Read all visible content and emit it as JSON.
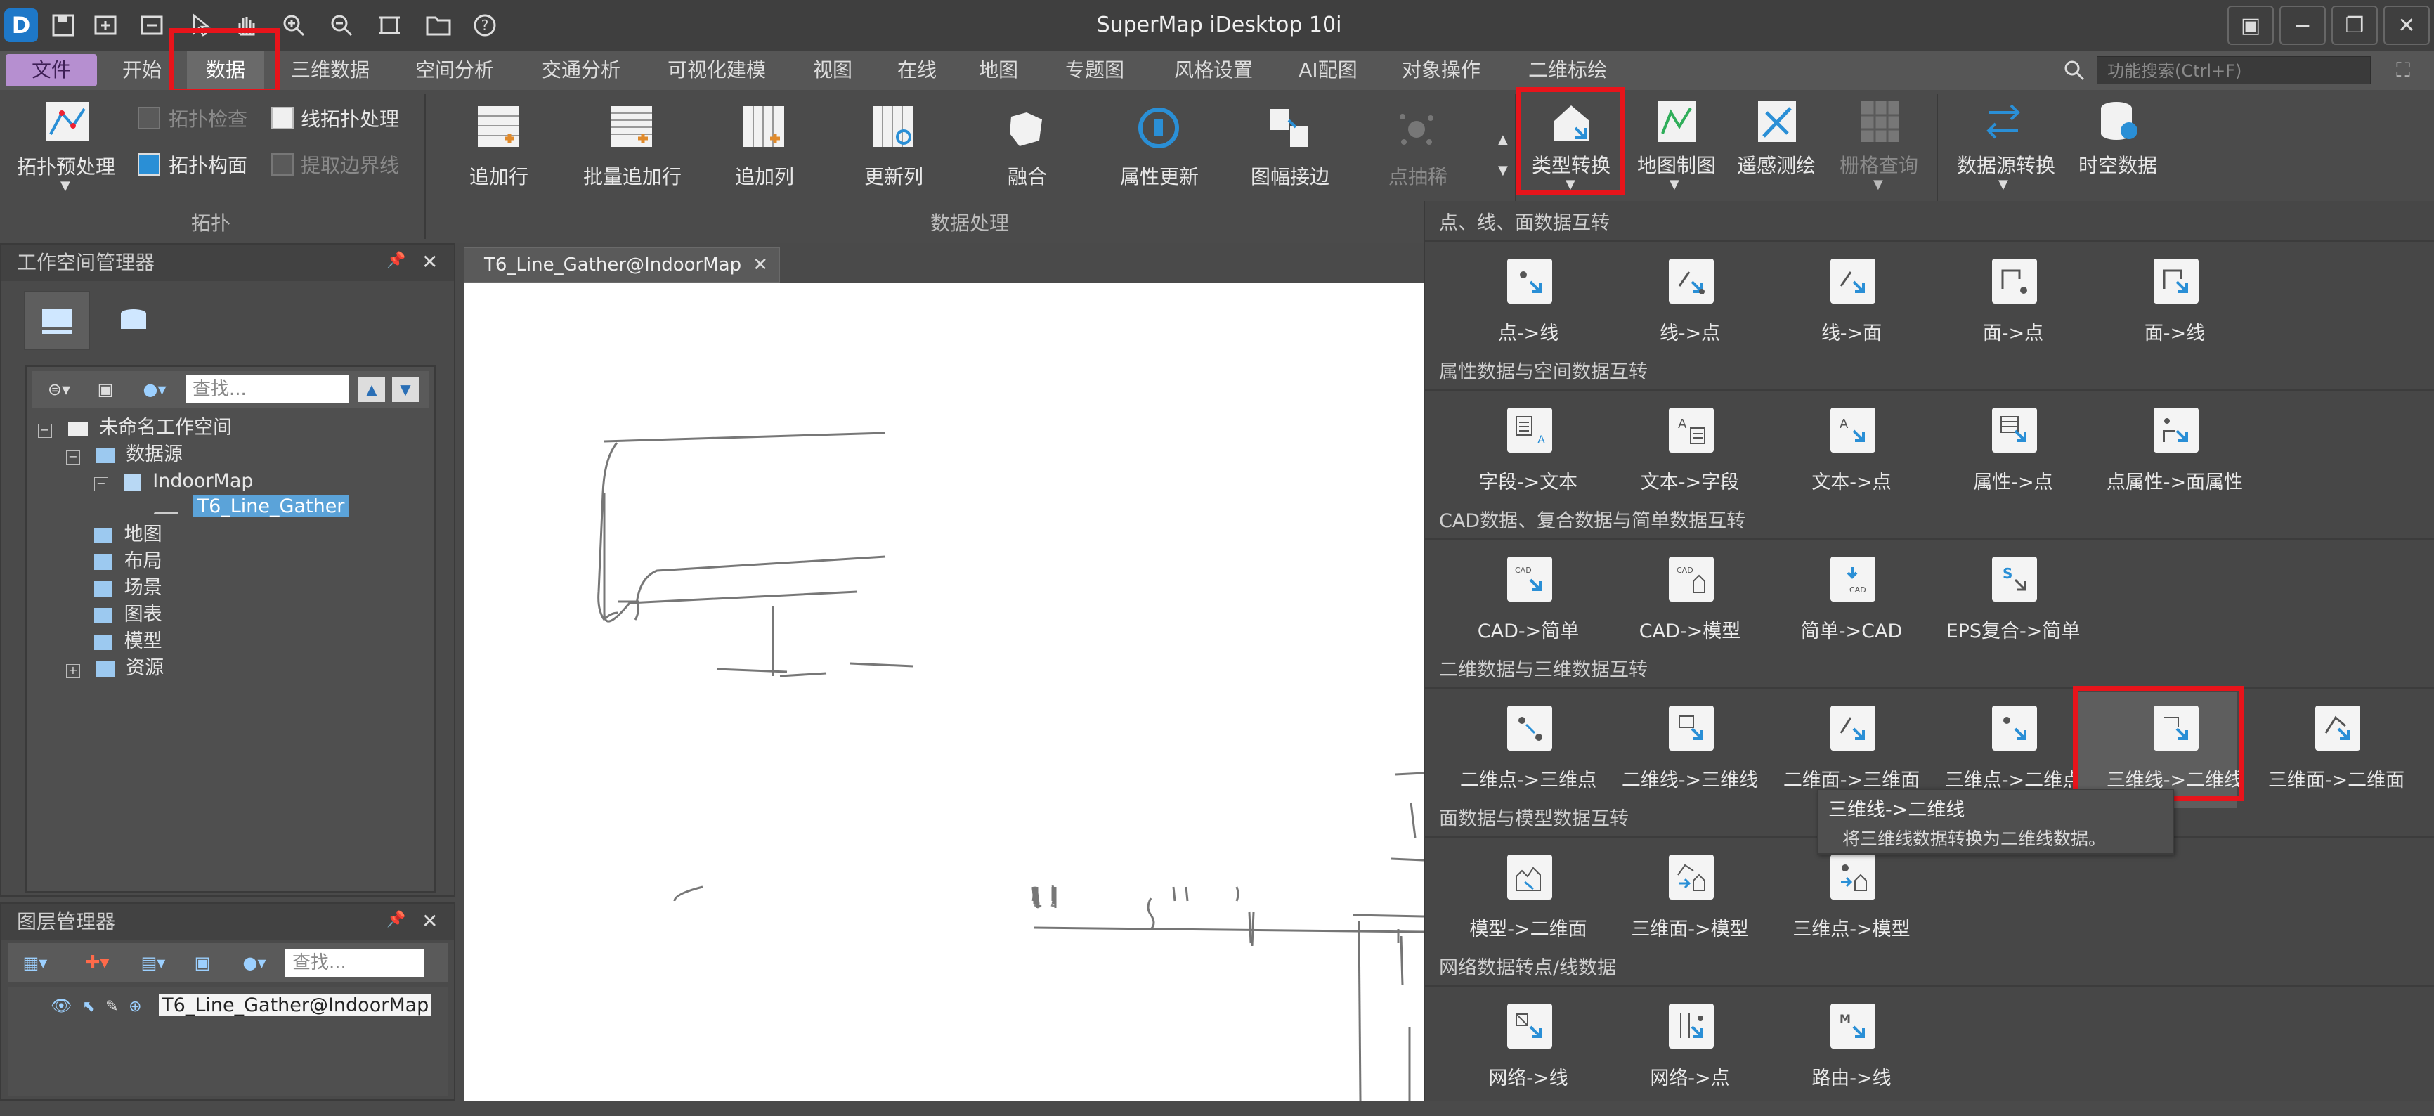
{
  "app": {
    "title": "SuperMap iDesktop 10i"
  },
  "menu": {
    "tabs": [
      "文件",
      "开始",
      "数据",
      "三维数据",
      "空间分析",
      "交通分析",
      "可视化建模",
      "视图",
      "在线",
      "地图",
      "专题图",
      "风格设置",
      "AI配图",
      "对象操作",
      "二维标绘"
    ],
    "search_placeholder": "功能搜索(Ctrl+F)"
  },
  "ribbon": {
    "topology": {
      "preprocess": "拓扑预处理",
      "check": "拓扑检查",
      "line_process": "线拓扑处理",
      "build_polygon": "拓扑构面",
      "extract_border": "提取边界线",
      "group": "拓扑"
    },
    "processing": {
      "items": [
        "追加行",
        "批量追加行",
        "追加列",
        "更新列",
        "融合",
        "属性更新",
        "图幅接边",
        "点抽稀"
      ],
      "group": "数据处理"
    },
    "more": [
      "类型转换",
      "地图制图",
      "遥感测绘",
      "栅格查询",
      "数据源转换",
      "时空数据"
    ]
  },
  "workspace": {
    "title": "工作空间管理器",
    "search_placeholder": "查找...",
    "tree": [
      "未命名工作空间",
      "数据源",
      "IndoorMap",
      "T6_Line_Gather",
      "地图",
      "布局",
      "场景",
      "图表",
      "模型",
      "资源"
    ]
  },
  "layers": {
    "title": "图层管理器",
    "search_placeholder": "查找...",
    "items": [
      "T6_Line_Gather@IndoorMap"
    ]
  },
  "map": {
    "tab": "T6_Line_Gather@IndoorMap"
  },
  "gallery": {
    "sections": [
      {
        "title": "点、线、面数据互转",
        "items": [
          "点->线",
          "线->点",
          "线->面",
          "面->点",
          "面->线"
        ]
      },
      {
        "title": "属性数据与空间数据互转",
        "items": [
          "字段->文本",
          "文本->字段",
          "文本->点",
          "属性->点",
          "点属性->面属性"
        ]
      },
      {
        "title": "CAD数据、复合数据与简单数据互转",
        "items": [
          "CAD->简单",
          "CAD->模型",
          "简单->CAD",
          "EPS复合->简单"
        ]
      },
      {
        "title": "二维数据与三维数据互转",
        "items": [
          "二维点->三维点",
          "二维线->三维线",
          "二维面->三维面",
          "三维点->二维点",
          "三维线->二维线",
          "三维面->二维面"
        ]
      },
      {
        "title": "面数据与模型数据互转",
        "items": [
          "模型->二维面",
          "三维面->模型",
          "三维点->模型"
        ]
      },
      {
        "title": "网络数据转点/线数据",
        "items": [
          "网络->线",
          "网络->点",
          "路由->线"
        ]
      }
    ],
    "tooltip": {
      "title": "三维线->二维线",
      "desc": "将三维线数据转换为二维线数据。"
    }
  },
  "colors": {
    "highlight": "#e8141b",
    "file_tab": "#b68fd0",
    "selection": "#5ba3d9",
    "accent_blue": "#2a8fd6"
  }
}
